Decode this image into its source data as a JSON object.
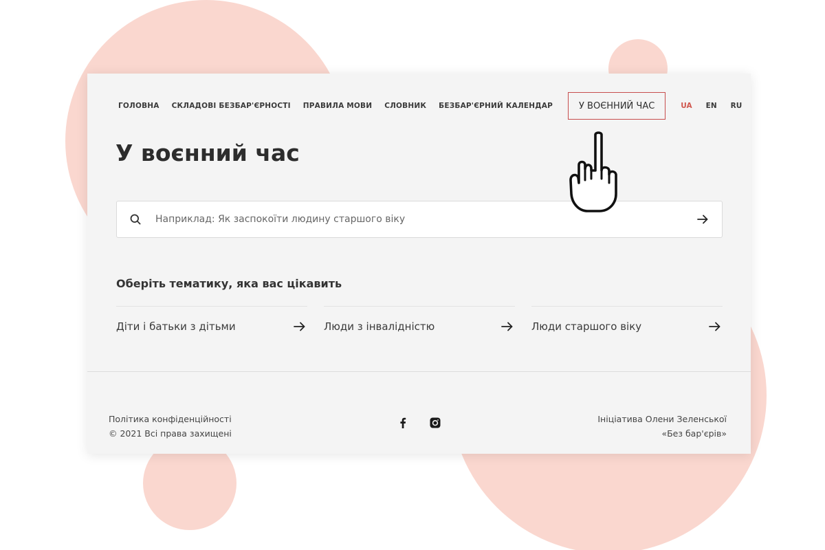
{
  "nav": {
    "items": [
      {
        "label": "ГОЛОВНА"
      },
      {
        "label": "СКЛАДОВІ БЕЗБАР'ЄРНОСТІ"
      },
      {
        "label": "ПРАВИЛА МОВИ"
      },
      {
        "label": "СЛОВНИК"
      },
      {
        "label": "БЕЗБАР'ЄРНИЙ КАЛЕНДАР"
      }
    ],
    "active_label": "У ВОЄННИЙ ЧАС",
    "active_border_color": "#c74c4c",
    "languages": [
      {
        "label": "UA",
        "current": true
      },
      {
        "label": "EN",
        "current": false
      },
      {
        "label": "RU",
        "current": false
      }
    ],
    "current_language_color": "#d0574e"
  },
  "page": {
    "title": "У воєнний час"
  },
  "search": {
    "placeholder": "Наприклад: Як заспокоїти людину старшого віку",
    "value": "",
    "icon": "search-icon",
    "submit_icon": "arrow-right-icon"
  },
  "topics": {
    "heading": "Оберіть тематику, яка вас цікавить",
    "items": [
      {
        "label": "Діти і батьки з дітьми"
      },
      {
        "label": "Люди з інвалідністю"
      },
      {
        "label": "Люди старшого віку"
      }
    ]
  },
  "footer": {
    "privacy": "Політика конфіденційності",
    "copyright": "© 2021 Всі права захищені",
    "social": [
      "facebook-icon",
      "instagram-icon"
    ],
    "initiative_line1": "Ініціатива Олени Зеленської",
    "initiative_line2": "«Без бар'єрів»"
  },
  "colors": {
    "background_blobs": "#fad7cf",
    "card_background": "#f4f4f4"
  }
}
